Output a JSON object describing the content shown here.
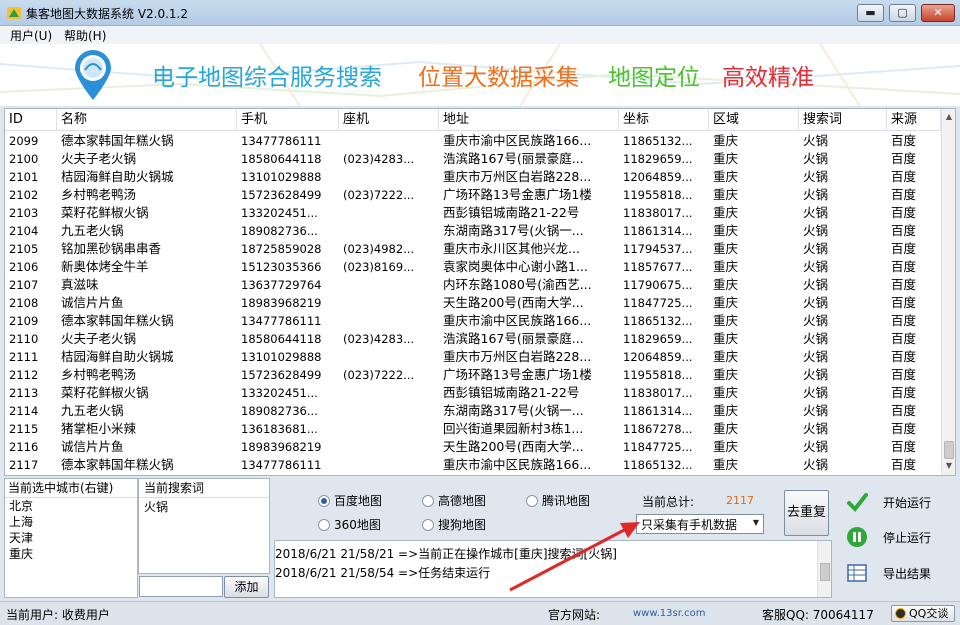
{
  "window": {
    "title": "集客地图大数据系统 V2.0.1.2",
    "minimize": "▬",
    "maximize": "▢",
    "close": "✕"
  },
  "menu": [
    "用户(U)",
    "帮助(H)"
  ],
  "banner": {
    "slogans": [
      "电子地图综合服务搜索",
      "位置大数据采集",
      "地图定位",
      "高效精准"
    ],
    "colors": [
      "#29a6d9",
      "#ee6f1c",
      "#4cc22f",
      "#e42c36"
    ]
  },
  "table": {
    "columns": [
      "ID",
      "名称",
      "手机",
      "座机",
      "地址",
      "坐标",
      "区域",
      "搜索词",
      "来源"
    ],
    "rows": [
      [
        "2099",
        "德本家韩国年糕火锅",
        "13477786111",
        "",
        "重庆市渝中区民族路166...",
        "11865132...",
        "重庆",
        "火锅",
        "百度"
      ],
      [
        "2100",
        "火夫子老火锅",
        "18580644118",
        "(023)4283...",
        "浩滨路167号(丽景豪庭...",
        "11829659...",
        "重庆",
        "火锅",
        "百度"
      ],
      [
        "2101",
        "桔园海鲜自助火锅城",
        "13101029888",
        "",
        "重庆市万州区白岩路228...",
        "12064859...",
        "重庆",
        "火锅",
        "百度"
      ],
      [
        "2102",
        "乡村鸭老鸭汤",
        "15723628499",
        "(023)7222...",
        "广场环路13号金惠广场1楼",
        "11955818...",
        "重庆",
        "火锅",
        "百度"
      ],
      [
        "2103",
        "菜籽花鲜椒火锅",
        "133202451...",
        "",
        "西彭镇铝城南路21-22号",
        "11838017...",
        "重庆",
        "火锅",
        "百度"
      ],
      [
        "2104",
        "九五老火锅",
        "189082736...",
        "",
        "东湖南路317号(火锅一...",
        "11861314...",
        "重庆",
        "火锅",
        "百度"
      ],
      [
        "2105",
        "铭加黑砂锅串串香",
        "18725859028",
        "(023)4982...",
        "重庆市永川区其他兴龙...",
        "11794537...",
        "重庆",
        "火锅",
        "百度"
      ],
      [
        "2106",
        "新奥体烤全牛羊",
        "15123035366",
        "(023)8169...",
        "袁家岗奥体中心谢小路1...",
        "11857677...",
        "重庆",
        "火锅",
        "百度"
      ],
      [
        "2107",
        "真滋味",
        "13637729764",
        "",
        "内环东路1080号(渝西艺...",
        "11790675...",
        "重庆",
        "火锅",
        "百度"
      ],
      [
        "2108",
        "诚信片片鱼",
        "18983968219",
        "",
        "天生路200号(西南大学...",
        "11847725...",
        "重庆",
        "火锅",
        "百度"
      ],
      [
        "2109",
        "德本家韩国年糕火锅",
        "13477786111",
        "",
        "重庆市渝中区民族路166...",
        "11865132...",
        "重庆",
        "火锅",
        "百度"
      ],
      [
        "2110",
        "火夫子老火锅",
        "18580644118",
        "(023)4283...",
        "浩滨路167号(丽景豪庭...",
        "11829659...",
        "重庆",
        "火锅",
        "百度"
      ],
      [
        "2111",
        "桔园海鲜自助火锅城",
        "13101029888",
        "",
        "重庆市万州区白岩路228...",
        "12064859...",
        "重庆",
        "火锅",
        "百度"
      ],
      [
        "2112",
        "乡村鸭老鸭汤",
        "15723628499",
        "(023)7222...",
        "广场环路13号金惠广场1楼",
        "11955818...",
        "重庆",
        "火锅",
        "百度"
      ],
      [
        "2113",
        "菜籽花鲜椒火锅",
        "133202451...",
        "",
        "西彭镇铝城南路21-22号",
        "11838017...",
        "重庆",
        "火锅",
        "百度"
      ],
      [
        "2114",
        "九五老火锅",
        "189082736...",
        "",
        "东湖南路317号(火锅一...",
        "11861314...",
        "重庆",
        "火锅",
        "百度"
      ],
      [
        "2115",
        "猪掌柜小米辣",
        "136183681...",
        "",
        "回兴街道果园新村3栋1...",
        "11867278...",
        "重庆",
        "火锅",
        "百度"
      ],
      [
        "2116",
        "诚信片片鱼",
        "18983968219",
        "",
        "天生路200号(西南大学...",
        "11847725...",
        "重庆",
        "火锅",
        "百度"
      ],
      [
        "2117",
        "德本家韩国年糕火锅",
        "13477786111",
        "",
        "重庆市渝中区民族路166...",
        "11865132...",
        "重庆",
        "火锅",
        "百度"
      ]
    ]
  },
  "city_panel": {
    "header": "当前选中城市(右键)",
    "cities": [
      "北京",
      "上海",
      "天津",
      "重庆"
    ]
  },
  "keyword_panel": {
    "header": "当前搜索词",
    "keyword": "火锅",
    "input_value": "",
    "add_label": "添加"
  },
  "map_sources": [
    {
      "label": "百度地图",
      "selected": true
    },
    {
      "label": "高德地图",
      "selected": false
    },
    {
      "label": "腾讯地图",
      "selected": false
    },
    {
      "label": "360地图",
      "selected": false
    },
    {
      "label": "搜狗地图",
      "selected": false
    }
  ],
  "total": {
    "label": "当前总计:",
    "value": "2117"
  },
  "mode_select": {
    "value": "只采集有手机数据"
  },
  "dedupe_label": "去重复",
  "log": [
    "2018/6/21 21/58/21 =>当前正在操作城市[重庆]搜索词[火锅]",
    "2018/6/21 21/58/54 =>任务结束运行"
  ],
  "actions": {
    "start": "开始运行",
    "stop": "停止运行",
    "export": "导出结果"
  },
  "status": {
    "user": "当前用户: 收费用户",
    "site_label": "官方网站:",
    "site_url": "www.13sr.com",
    "qq": "客服QQ: 70064117",
    "qq_button": "QQ交谈"
  }
}
